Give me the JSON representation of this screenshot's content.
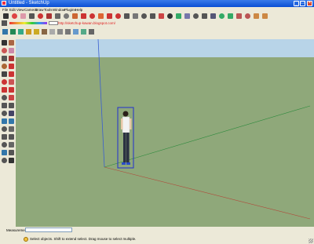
{
  "window": {
    "title": "Untitled - SketchUp",
    "minimize": "_",
    "maximize": "□",
    "close": "×"
  },
  "menu": [
    "File",
    "Edit",
    "View",
    "Camera",
    "Draw",
    "Tools",
    "Window",
    "Plugins",
    "Help"
  ],
  "blog_url": "http://sketchup-kawan.blogspot.com/",
  "status_bar": {
    "measurements_label": "Measurements",
    "measurements_value": "",
    "hint": "Select objects. Shift to extend select. Drag mouse to select multiple."
  },
  "colors": {
    "sky": "#b8d4e8",
    "ground": "#8fa87a",
    "axis_blue": "#3a5fd0",
    "axis_green": "#2c8a3c",
    "axis_red": "#b04a3a",
    "selection": "#2030d0"
  },
  "toolbars": {
    "top": [
      "select-icon",
      "eraser-icon",
      "pencil-icon",
      "line-icon",
      "arc-icon",
      "rectangle-icon",
      "circle-icon",
      "polygon-icon",
      "push-pull-icon",
      "move-icon",
      "rotate-icon",
      "follow-me-icon",
      "scale-icon",
      "offset-icon",
      "tape-measure-icon",
      "dimension-icon",
      "protractor-icon",
      "text-icon",
      "axes-icon",
      "3d-text-icon",
      "orbit-icon",
      "pan-icon",
      "zoom-icon",
      "zoom-window-icon",
      "zoom-extents-icon",
      "previous-view-icon",
      "next-view-icon",
      "get-models-icon",
      "share-model-icon",
      "components-icon",
      "materials-icon"
    ]
  }
}
